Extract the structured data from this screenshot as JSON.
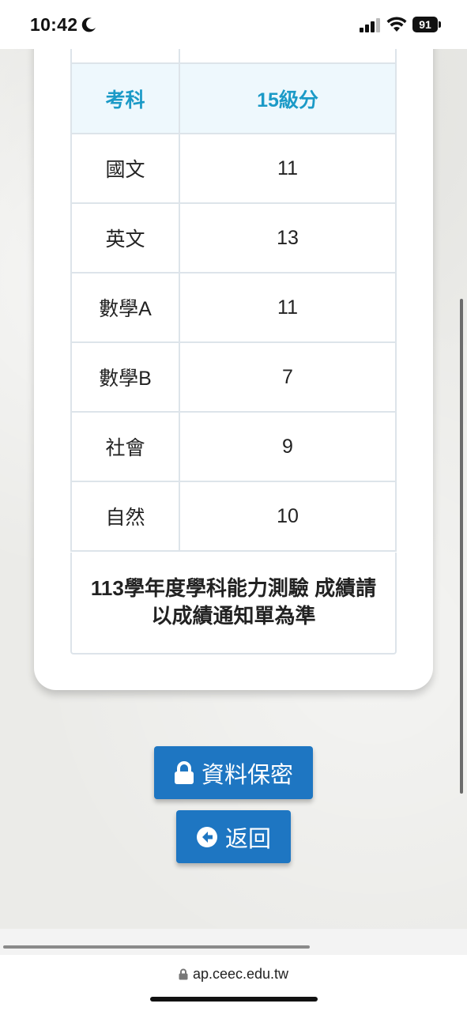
{
  "status_bar": {
    "time": "10:42",
    "battery": "91"
  },
  "table": {
    "headers": {
      "subject": "考科",
      "score": "15級分"
    },
    "rows": [
      {
        "subject": "國文",
        "score": "11"
      },
      {
        "subject": "英文",
        "score": "13"
      },
      {
        "subject": "數學A",
        "score": "11"
      },
      {
        "subject": "數學B",
        "score": "7"
      },
      {
        "subject": "社會",
        "score": "9"
      },
      {
        "subject": "自然",
        "score": "10"
      }
    ]
  },
  "note": {
    "line1": "113學年度學科能力測驗 成績請",
    "line2": "以成績通知單為準"
  },
  "buttons": {
    "privacy": "資料保密",
    "back": "返回"
  },
  "browser": {
    "url": "ap.ceec.edu.tw"
  },
  "icons": [
    "moon-icon",
    "signal-icon",
    "wifi-icon",
    "lock-icon",
    "back-arrow-icon"
  ],
  "colors": {
    "accent": "#1e76c2",
    "header_text": "#1b9ac7",
    "header_bg": "#eef8fd"
  }
}
